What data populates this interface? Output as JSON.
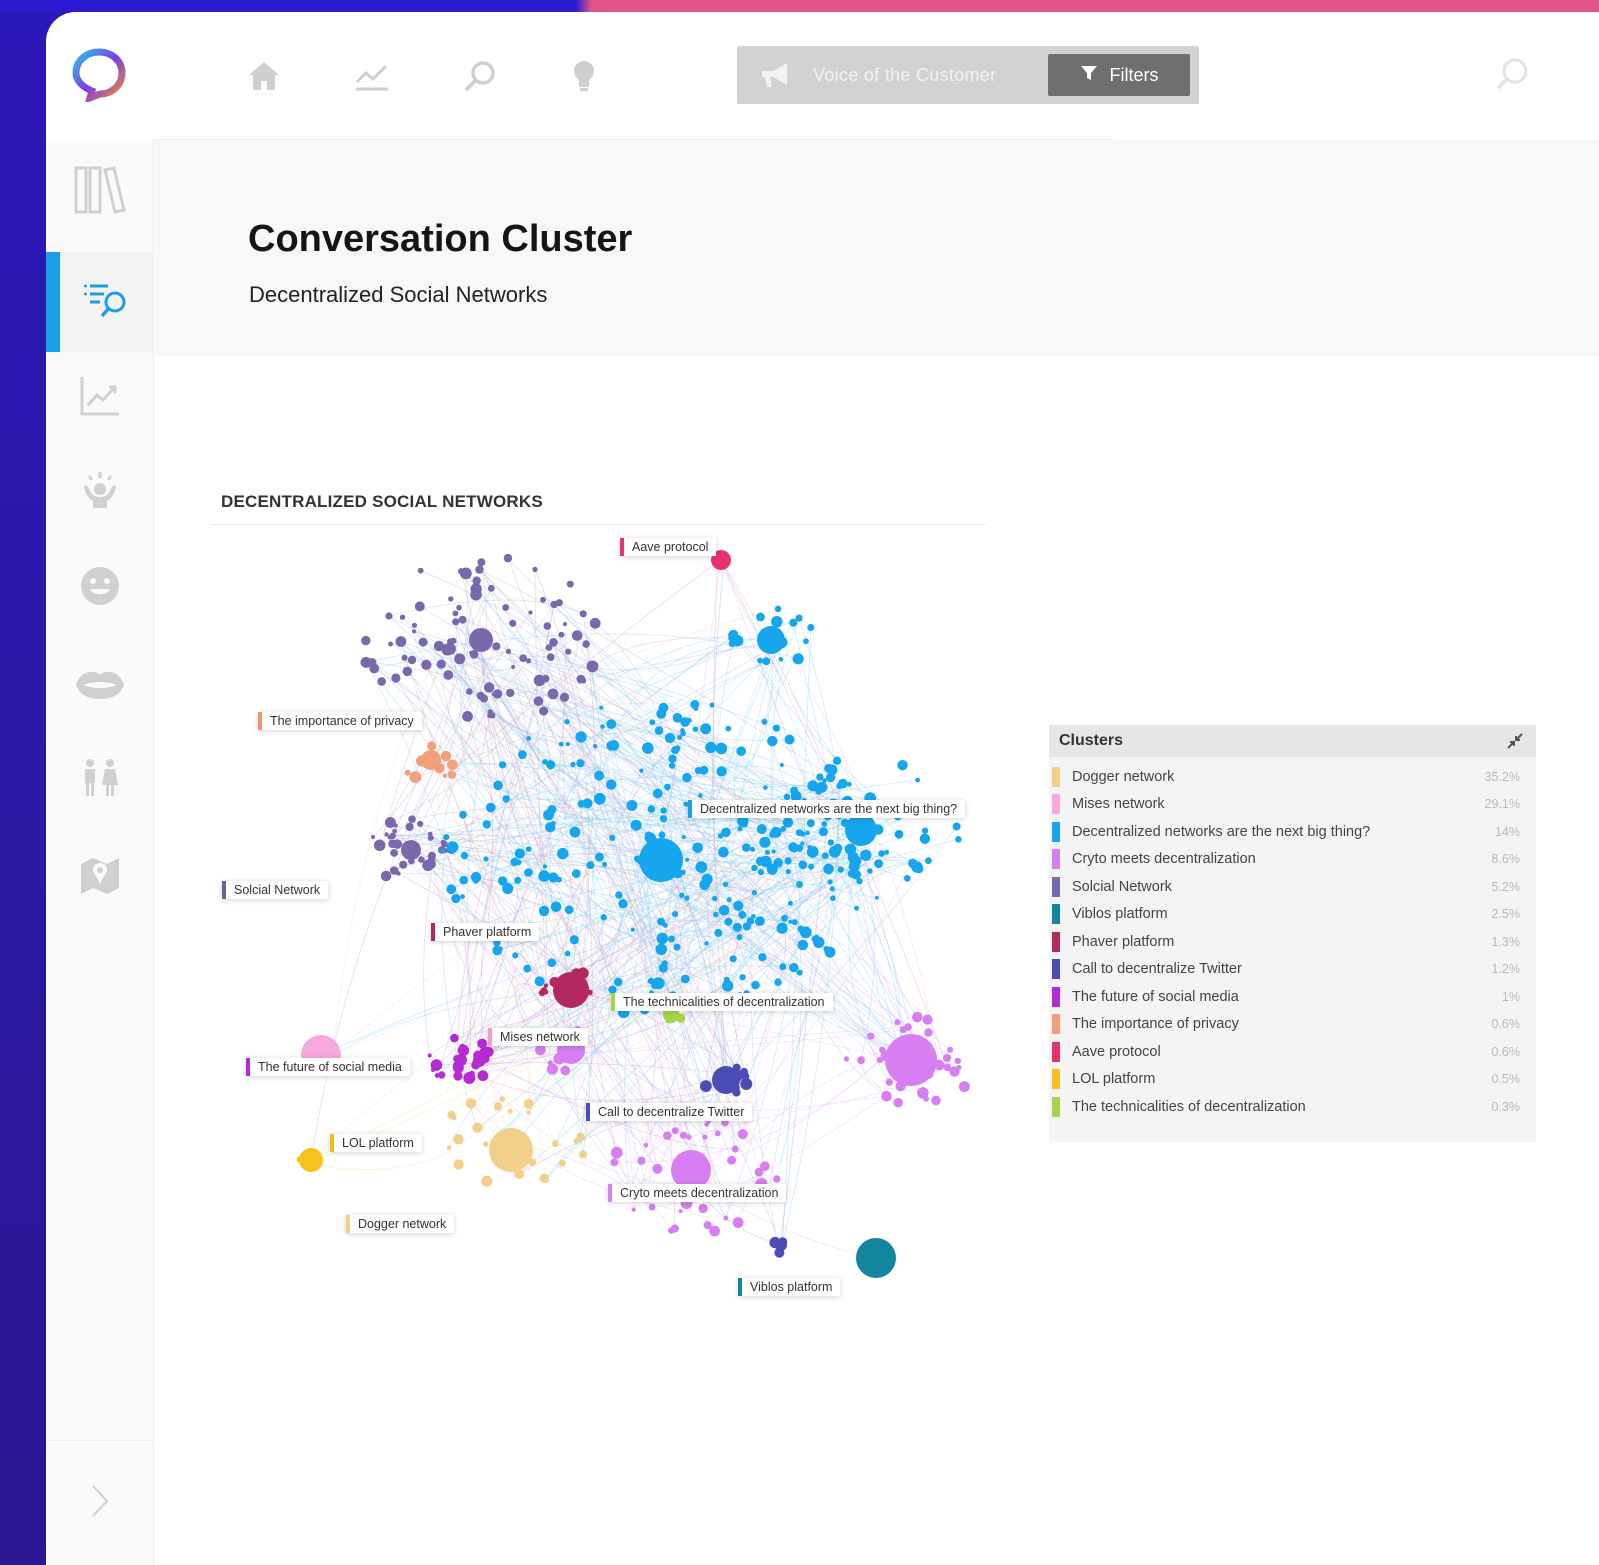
{
  "topbar": {
    "source_label": "Voice of the Customer",
    "filters_label": "Filters",
    "nav": [
      {
        "icon": "home-icon"
      },
      {
        "icon": "trend-line-icon"
      },
      {
        "icon": "search-icon"
      },
      {
        "icon": "lightbulb-icon"
      }
    ]
  },
  "sidebar": {
    "items": [
      {
        "icon": "library-icon",
        "active": false
      },
      {
        "icon": "list-search-icon",
        "active": true
      },
      {
        "icon": "trend-chart-icon",
        "active": false
      },
      {
        "icon": "idea-person-icon",
        "active": false
      },
      {
        "icon": "smiley-icon",
        "active": false
      },
      {
        "icon": "mouth-icon",
        "active": false
      },
      {
        "icon": "people-icon",
        "active": false
      },
      {
        "icon": "map-pin-icon",
        "active": false
      }
    ],
    "expand_icon": "chevron-right-icon"
  },
  "header": {
    "title": "Conversation Cluster",
    "subtitle": "Decentralized Social Networks"
  },
  "graph": {
    "section_title": "DECENTRALIZED SOCIAL NETWORKS",
    "labels": [
      {
        "text": "Aave protocol",
        "color": "#e8336a"
      },
      {
        "text": "The importance of privacy",
        "color": "#f0946a"
      },
      {
        "text": "Decentralized networks are the next big thing?",
        "color": "#1aa3e8"
      },
      {
        "text": "Solcial Network",
        "color": "#6e5fa8"
      },
      {
        "text": "Phaver platform",
        "color": "#b3285e"
      },
      {
        "text": "The technicalities of decentralization",
        "color": "#a6d54a"
      },
      {
        "text": "Mises network",
        "color": "#f59ad6"
      },
      {
        "text": "The future of social media",
        "color": "#b52ad2"
      },
      {
        "text": "Call to decentralize Twitter",
        "color": "#4b4db5"
      },
      {
        "text": "LOL platform",
        "color": "#f3bb18"
      },
      {
        "text": "Cryto meets decentralization",
        "color": "#d582f2"
      },
      {
        "text": "Dogger network",
        "color": "#f3d08a"
      },
      {
        "text": "Viblos platform",
        "color": "#13869e"
      }
    ]
  },
  "clusters_panel": {
    "title": "Clusters",
    "items": [
      {
        "name": "Dogger network",
        "pct": "35.2%",
        "color": "#f3d08a"
      },
      {
        "name": "Mises network",
        "pct": "29.1%",
        "color": "#f9a8dc"
      },
      {
        "name": "Decentralized networks are the next big thing?",
        "pct": "14%",
        "color": "#16a6ee"
      },
      {
        "name": "Cryto meets decentralization",
        "pct": "8.6%",
        "color": "#d77ff2"
      },
      {
        "name": "Solcial Network",
        "pct": "5.2%",
        "color": "#7a68ac"
      },
      {
        "name": "Viblos platform",
        "pct": "2.5%",
        "color": "#13869e"
      },
      {
        "name": "Phaver platform",
        "pct": "1.3%",
        "color": "#b3285e"
      },
      {
        "name": "Call to decentralize Twitter",
        "pct": "1.2%",
        "color": "#4b4db5"
      },
      {
        "name": "The future of social media",
        "pct": "1%",
        "color": "#b52ad2"
      },
      {
        "name": "The importance of privacy",
        "pct": "0.6%",
        "color": "#f3a07a"
      },
      {
        "name": "Aave protocol",
        "pct": "0.6%",
        "color": "#e8336a"
      },
      {
        "name": "LOL platform",
        "pct": "0.5%",
        "color": "#f7c21a"
      },
      {
        "name": "The technicalities of decentralization",
        "pct": "0.3%",
        "color": "#a6d54a"
      }
    ]
  }
}
